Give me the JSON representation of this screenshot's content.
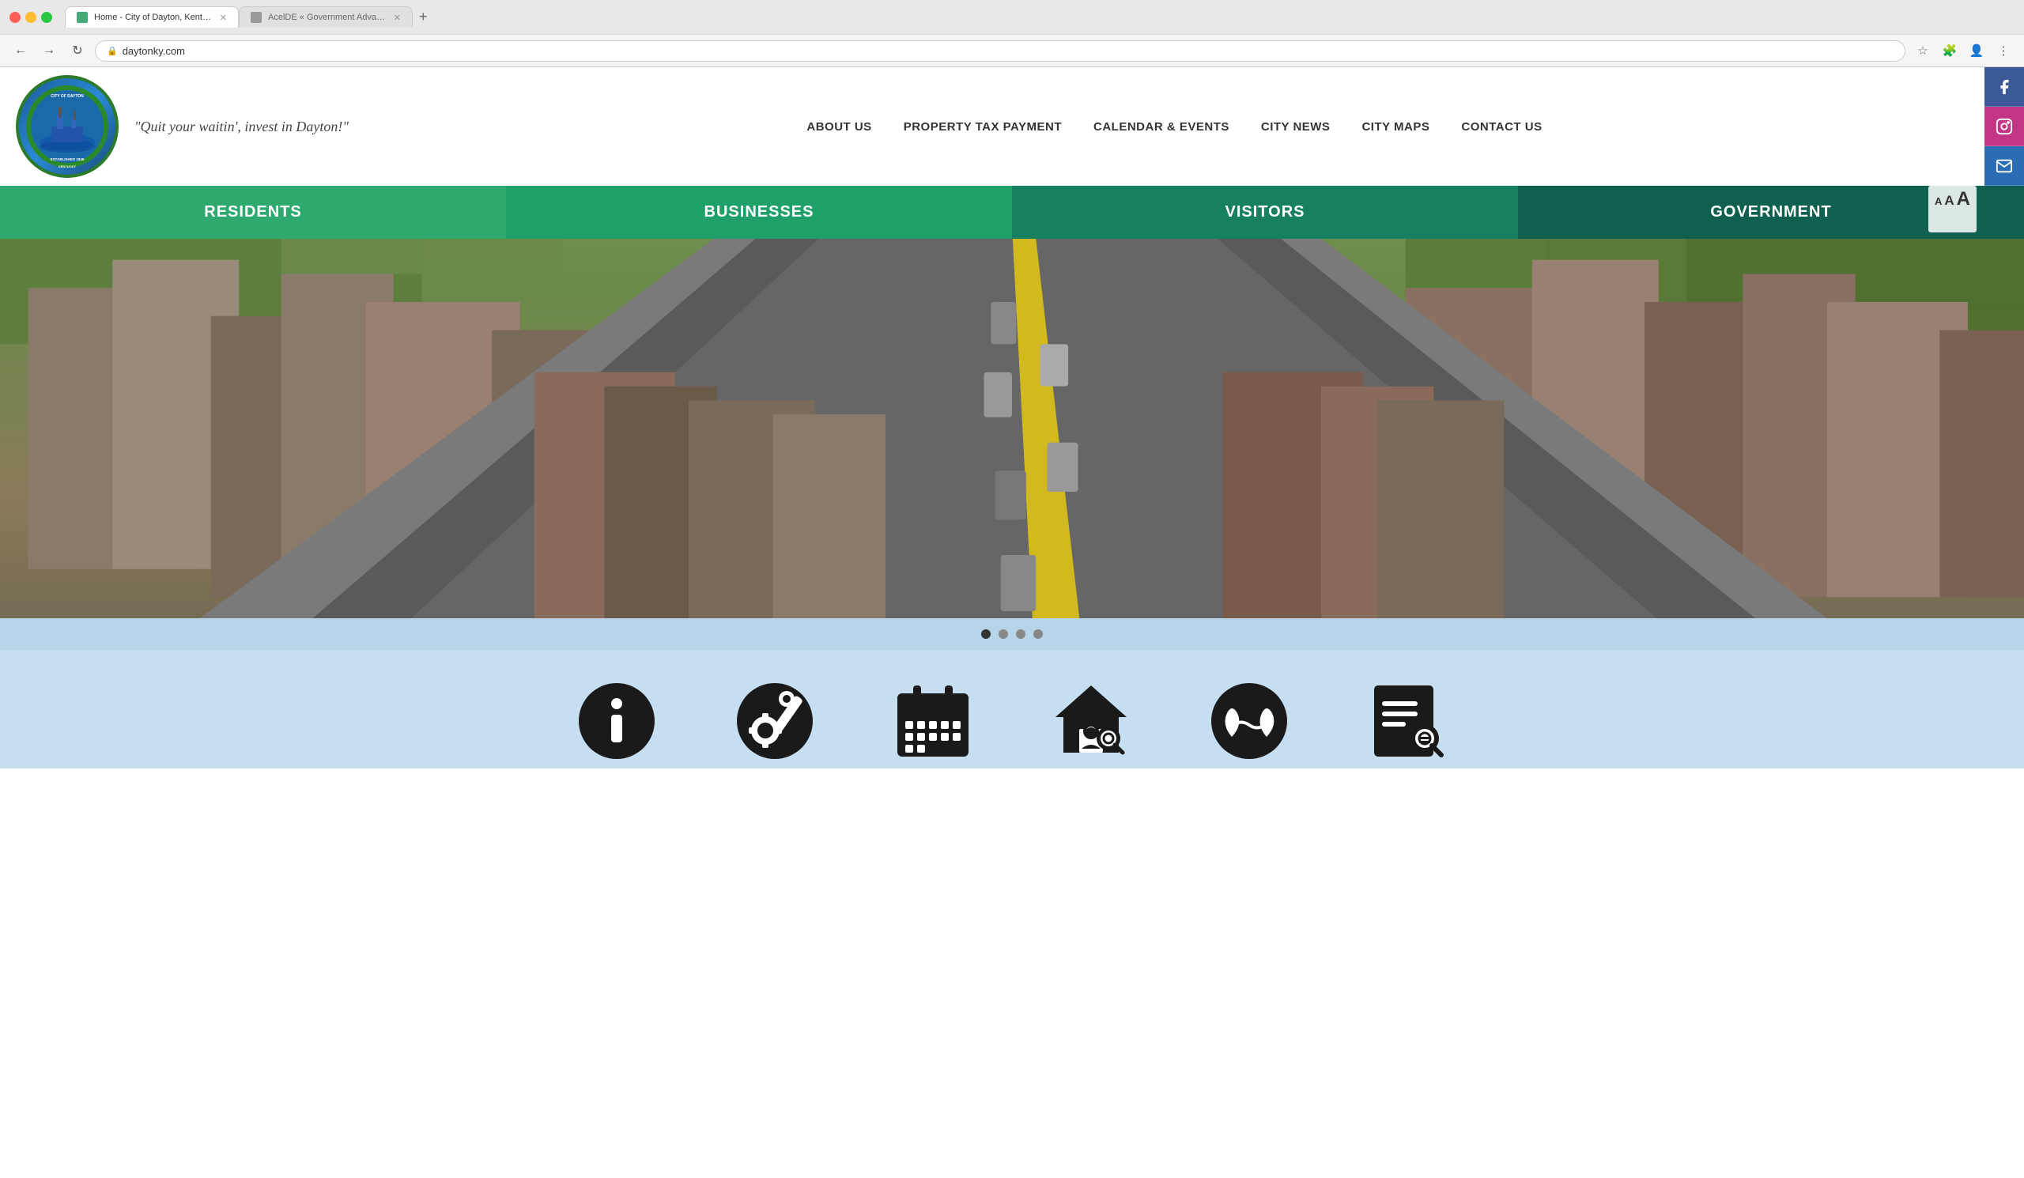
{
  "browser": {
    "tabs": [
      {
        "id": 1,
        "title": "Home - City of Dayton, Kentu...",
        "url": "daytonky.com",
        "active": true,
        "favicon_color": "#4a7"
      },
      {
        "id": 2,
        "title": "AcelDE « Government Advanta...",
        "url": "",
        "active": false,
        "favicon_color": "#777"
      }
    ],
    "address": "daytonky.com"
  },
  "header": {
    "logo_alt": "City of Dayton Kentucky seal",
    "tagline": "\"Quit your waitin', invest in Dayton!\"",
    "nav": {
      "items": [
        {
          "label": "ABOUT US",
          "id": "about-us"
        },
        {
          "label": "PROPERTY TAX PAYMENT",
          "id": "property-tax"
        },
        {
          "label": "CALENDAR & EVENTS",
          "id": "calendar-events"
        },
        {
          "label": "CITY NEWS",
          "id": "city-news"
        },
        {
          "label": "CITY MAPS",
          "id": "city-maps"
        },
        {
          "label": "CONTACT US",
          "id": "contact-us"
        }
      ]
    },
    "social": {
      "facebook_label": "Facebook",
      "instagram_label": "Instagram",
      "email_label": "Email"
    }
  },
  "secondary_nav": {
    "items": [
      {
        "label": "RESIDENTS",
        "id": "residents",
        "color": "#2eaa70"
      },
      {
        "label": "BUSINESSES",
        "id": "businesses",
        "color": "#1a9a60"
      },
      {
        "label": "VISITORS",
        "id": "visitors",
        "color": "#157a50"
      },
      {
        "label": "GOVERNMENT",
        "id": "government",
        "color": "#0e6040"
      }
    ]
  },
  "accessibility": {
    "small_a": "A",
    "medium_a": "A",
    "large_a": "A"
  },
  "hero": {
    "alt": "Aerial view of Dayton Kentucky streets"
  },
  "slider": {
    "dots": [
      {
        "active": true
      },
      {
        "active": false
      },
      {
        "active": false
      },
      {
        "active": false
      }
    ]
  },
  "quick_links": {
    "items": [
      {
        "id": "info",
        "label": "Info",
        "icon": "info"
      },
      {
        "id": "services",
        "label": "Services",
        "icon": "gear"
      },
      {
        "id": "calendar",
        "label": "Calendar",
        "icon": "calendar"
      },
      {
        "id": "property",
        "label": "Property Search",
        "icon": "house-search"
      },
      {
        "id": "utilities",
        "label": "Utilities",
        "icon": "water"
      },
      {
        "id": "documents",
        "label": "Documents",
        "icon": "document-search"
      }
    ]
  }
}
